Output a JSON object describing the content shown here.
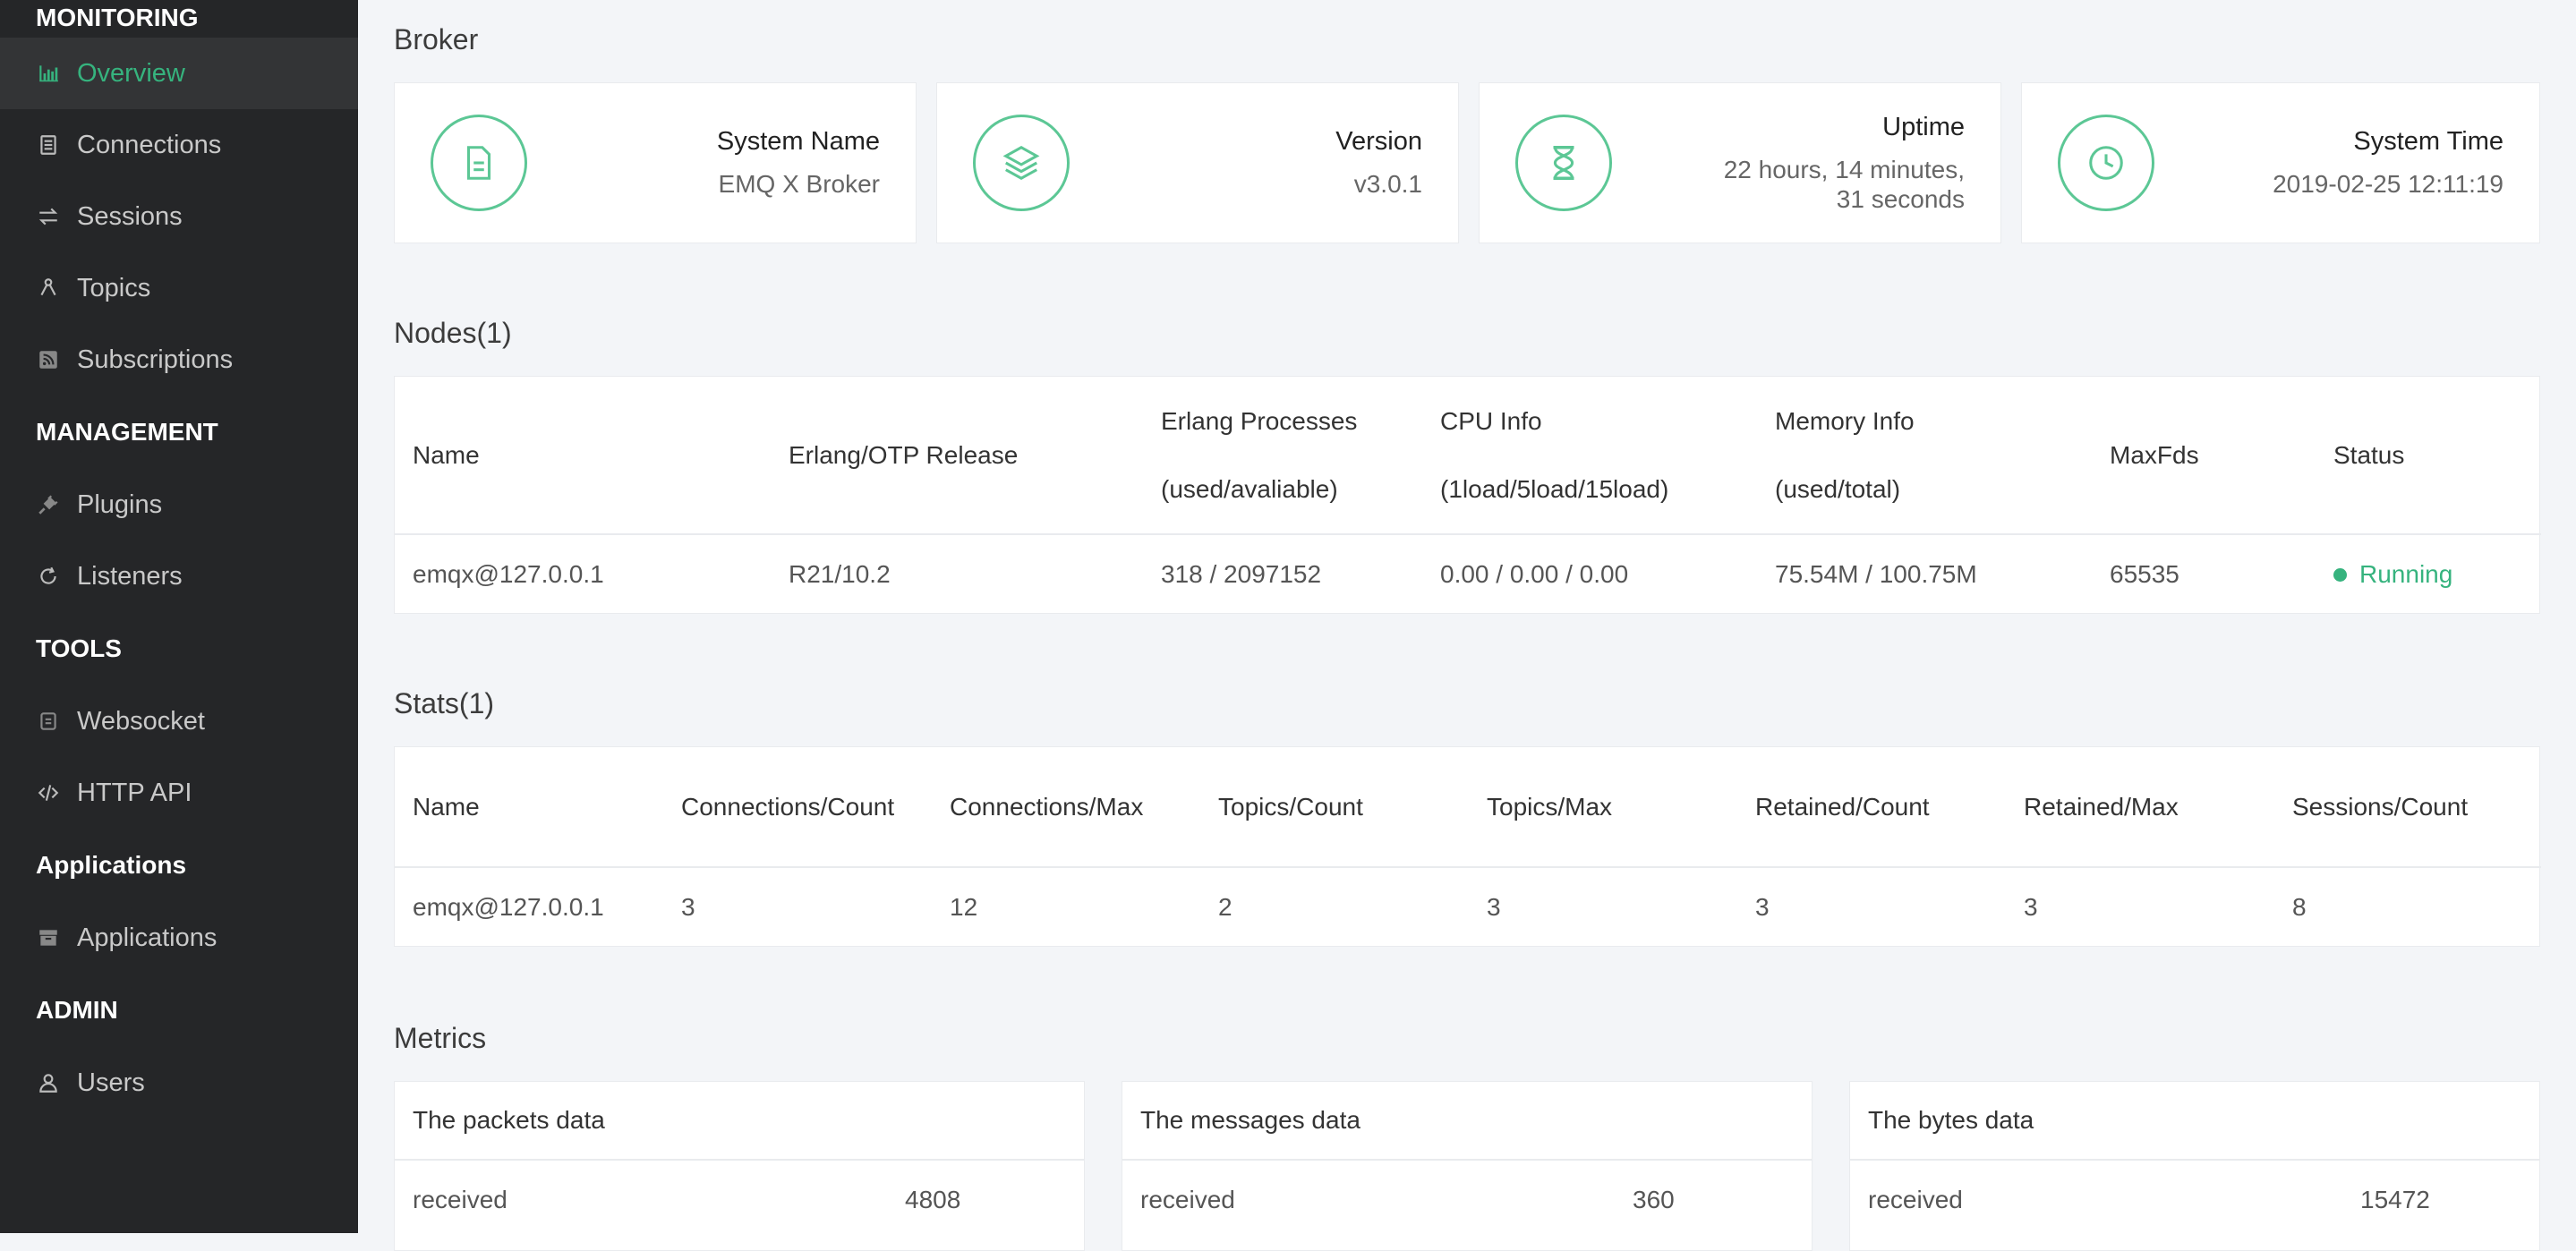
{
  "sidebar": {
    "groups": [
      {
        "title": "MONITORING",
        "items": [
          {
            "label": "Overview",
            "icon": "bar-chart-icon"
          },
          {
            "label": "Connections",
            "icon": "document-icon"
          },
          {
            "label": "Sessions",
            "icon": "swap-arrows-icon"
          },
          {
            "label": "Topics",
            "icon": "topic-nodes-icon"
          },
          {
            "label": "Subscriptions",
            "icon": "rss-icon"
          }
        ]
      },
      {
        "title": "MANAGEMENT",
        "items": [
          {
            "label": "Plugins",
            "icon": "plug-icon"
          },
          {
            "label": "Listeners",
            "icon": "refresh-icon"
          }
        ]
      },
      {
        "title": "TOOLS",
        "items": [
          {
            "label": "Websocket",
            "icon": "socket-icon"
          },
          {
            "label": "HTTP API",
            "icon": "code-icon"
          }
        ]
      },
      {
        "title": "Applications",
        "items": [
          {
            "label": "Applications",
            "icon": "archive-icon"
          }
        ]
      },
      {
        "title": "ADMIN",
        "items": [
          {
            "label": "Users",
            "icon": "user-icon"
          }
        ]
      }
    ],
    "active": "Overview"
  },
  "broker": {
    "title": "Broker",
    "cards": [
      {
        "key": "System Name",
        "value": "EMQ X Broker",
        "icon": "file-icon"
      },
      {
        "key": "Version",
        "value": "v3.0.1",
        "icon": "layers-icon"
      },
      {
        "key": "Uptime",
        "value": "22 hours, 14 minutes,",
        "value2": "31 seconds",
        "icon": "hourglass-icon"
      },
      {
        "key": "System Time",
        "value": "2019-02-25 12:11:19",
        "icon": "clock-icon"
      }
    ]
  },
  "nodes": {
    "title": "Nodes(1)",
    "headers": {
      "name": "Name",
      "otp": "Erlang/OTP Release",
      "proc1": "Erlang Processes",
      "proc2": "(used/avaliable)",
      "cpu1": "CPU Info",
      "cpu2": "(1load/5load/15load)",
      "mem1": "Memory Info",
      "mem2": "(used/total)",
      "maxfds": "MaxFds",
      "status": "Status"
    },
    "row": {
      "name": "emqx@127.0.0.1",
      "otp": "R21/10.2",
      "proc": "318 / 2097152",
      "cpu": "0.00 / 0.00 / 0.00",
      "mem": "75.54M / 100.75M",
      "maxfds": "65535",
      "status": "Running"
    }
  },
  "stats": {
    "title": "Stats(1)",
    "headers": [
      "Name",
      "Connections/Count",
      "Connections/Max",
      "Topics/Count",
      "Topics/Max",
      "Retained/Count",
      "Retained/Max",
      "Sessions/Count"
    ],
    "row": [
      "emqx@127.0.0.1",
      "3",
      "12",
      "2",
      "3",
      "3",
      "3",
      "8"
    ]
  },
  "metrics": {
    "title": "Metrics",
    "panels": [
      {
        "title": "The packets data",
        "label": "received",
        "value": "4808"
      },
      {
        "title": "The messages data",
        "label": "received",
        "value": "360"
      },
      {
        "title": "The bytes data",
        "label": "received",
        "value": "15472"
      }
    ]
  },
  "colors": {
    "accent": "#36b37e",
    "sidebar_bg": "#252628"
  }
}
